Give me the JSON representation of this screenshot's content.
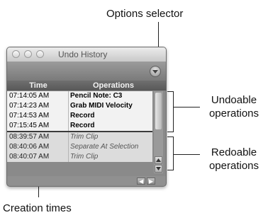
{
  "callouts": {
    "options_selector": "Options selector",
    "undoable": [
      "Undoable",
      "operations"
    ],
    "redoable": [
      "Redoable",
      "operations"
    ],
    "creation_times": "Creation times"
  },
  "window": {
    "title": "Undo History",
    "columns": {
      "time": "Time",
      "operations": "Operations"
    },
    "undoable_rows": [
      {
        "time": "07:14:05 AM",
        "op": "Pencil Note: C3"
      },
      {
        "time": "07:14:23 AM",
        "op": "Grab MIDI Velocity"
      },
      {
        "time": "07:14:53 AM",
        "op": "Record"
      },
      {
        "time": "07:15:45 AM",
        "op": "Record"
      }
    ],
    "redoable_rows": [
      {
        "time": "08:39:57 AM",
        "op": "Trim Clip"
      },
      {
        "time": "08:40:06 AM",
        "op": "Separate At Selection"
      },
      {
        "time": "08:40:07 AM",
        "op": "Trim Clip"
      }
    ],
    "icons": {
      "options": "chevron-down-icon",
      "scroll_up": "arrow-up-icon",
      "scroll_down": "arrow-down-icon",
      "scroll_left": "arrow-left-icon",
      "scroll_right": "arrow-right-icon"
    }
  }
}
